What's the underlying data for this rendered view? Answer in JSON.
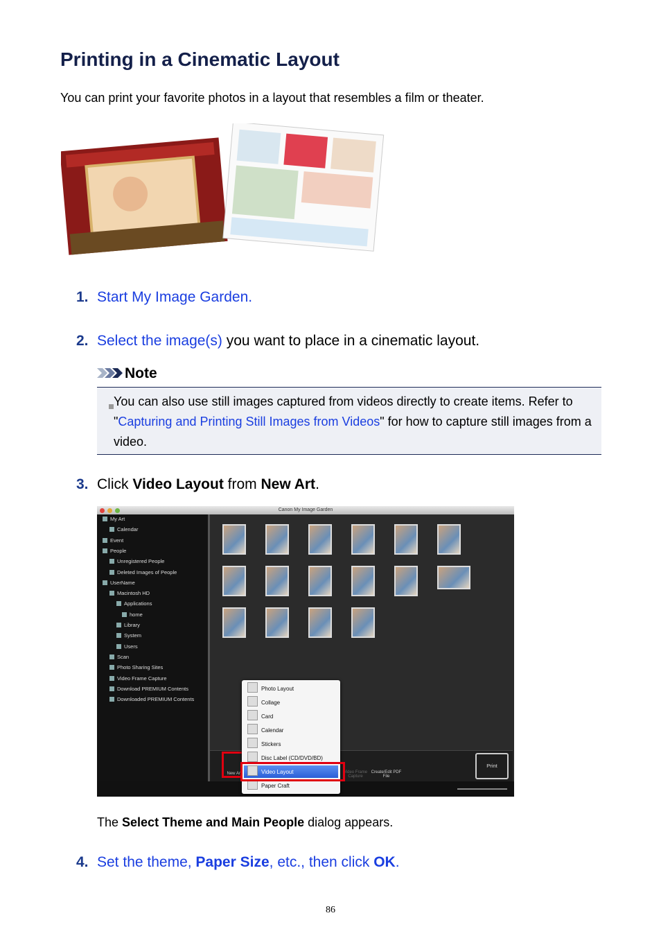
{
  "title": "Printing in a Cinematic Layout",
  "intro": "You can print your favorite photos in a layout that resembles a film or theater.",
  "steps": [
    {
      "num": "1.",
      "link": "Start My Image Garden."
    },
    {
      "num": "2.",
      "link": "Select the image(s)",
      "rest": " you want to place in a cinematic layout."
    },
    {
      "num": "3.",
      "pre": "Click ",
      "b1": "Video Layout",
      "mid": " from ",
      "b2": "New Art",
      "post": "."
    },
    {
      "num": "4.",
      "a": "Set the theme, ",
      "b": "Paper Size",
      "c": ", etc., then click ",
      "d": "OK",
      "e": "."
    }
  ],
  "note": {
    "heading": "Note",
    "text1": "You can also use still images captured from videos directly to create items. Refer to \"",
    "link": "Capturing and Printing Still Images from Videos",
    "text2": "\" for how to capture still images from a video."
  },
  "screenshot": {
    "window_title": "Canon My Image Garden",
    "sidebar": [
      "My Art",
      "Calendar",
      "Event",
      "People",
      "Unregistered People",
      "Deleted Images of People",
      "UserName",
      "Macintosh HD",
      "Applications",
      "home",
      "Library",
      "System",
      "Users",
      "Scan",
      "Photo Sharing Sites",
      "Video Frame Capture",
      "Download PREMIUM Contents",
      "Downloaded PREMIUM Contents"
    ],
    "menu": [
      "Photo Layout",
      "Collage",
      "Card",
      "Calendar",
      "Stickers",
      "Disc Label (CD/DVD/BD)",
      "Video Layout",
      "Paper Craft"
    ],
    "selected_menu": "Video Layout",
    "toolbar": {
      "new_art": "New Art",
      "video_frame": "Video Frame Capture",
      "pdf": "Create/Edit PDF File",
      "print": "Print"
    }
  },
  "caption": {
    "pre": "The ",
    "bold": "Select Theme and Main People",
    "post": " dialog appears."
  },
  "page_number": "86"
}
